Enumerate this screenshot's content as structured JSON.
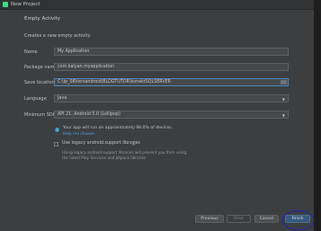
{
  "window": {
    "title": "New Project"
  },
  "header": {
    "title": "Empty Activity"
  },
  "subheader": {
    "text": "Creates a new empty activity"
  },
  "form": {
    "name": {
      "label": "Name",
      "value": "My Application"
    },
    "package": {
      "label": "Package name",
      "value": "com.kalyan.myapplication"
    },
    "save_location": {
      "label": "Save location",
      "value": "C:\\Ip_08\\tersandroid\\BLOGTUTOR\\konektSQLSERVER"
    },
    "language": {
      "label": "Language",
      "value": "Java"
    },
    "min_sdk": {
      "label": "Minimum SDK",
      "value": "API 21: Android 5.0 (Lollipop)"
    }
  },
  "info": {
    "text": "Your app will run on approximately 98.0% of devices.",
    "link": "Help me choose"
  },
  "legacy": {
    "label": "Use legacy android.support libraries",
    "desc_lines": [
      "Using legacy android.support libraries will prevent you from using",
      "the latest Play Services and Jetpack libraries"
    ]
  },
  "footer": {
    "previous": "Previous",
    "next": "Next",
    "cancel": "Cancel",
    "finish": "Finish"
  },
  "colors": {
    "accent": "#365880",
    "link": "#589df6",
    "annotation_circle": "#2020b8"
  }
}
